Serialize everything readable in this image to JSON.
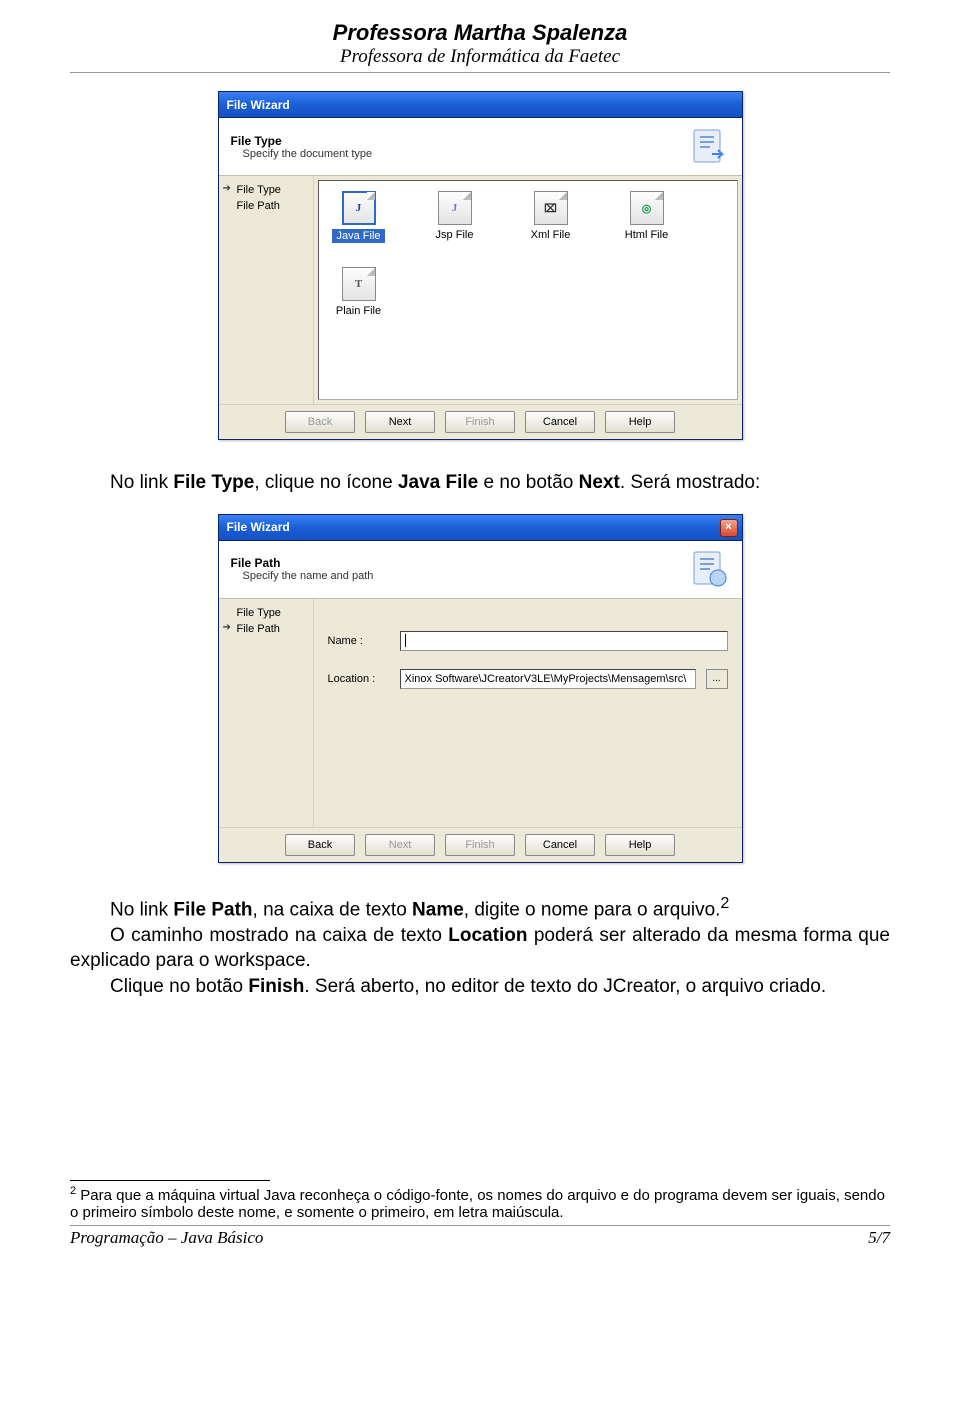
{
  "header": {
    "title": "Professora Martha Spalenza",
    "sub": "Professora de Informática da Faetec"
  },
  "dialog1": {
    "title": "File Wizard",
    "section_title": "File Type",
    "section_desc": "Specify the document type",
    "sidebar": {
      "items": [
        {
          "label": "File Type",
          "selected": true
        },
        {
          "label": "File Path",
          "selected": false
        }
      ]
    },
    "files": [
      {
        "label": "Java File",
        "glyph": "J",
        "color": "#1a3fb5",
        "selected": true
      },
      {
        "label": "Jsp File",
        "glyph": "J",
        "color": "#8a6ad0",
        "selected": false
      },
      {
        "label": "Xml File",
        "glyph": "⌧",
        "color": "#333",
        "selected": false
      },
      {
        "label": "Html File",
        "glyph": "◎",
        "color": "#0a9a4a",
        "selected": false
      },
      {
        "label": "Plain File",
        "glyph": "T",
        "color": "#555",
        "selected": false
      }
    ],
    "buttons": {
      "back": "Back",
      "next": "Next",
      "finish": "Finish",
      "cancel": "Cancel",
      "help": "Help"
    }
  },
  "para1_pre": "No link ",
  "para1_b1": "File Type",
  "para1_mid": ", clique no ícone ",
  "para1_b2": "Java File",
  "para1_mid2": " e no botão ",
  "para1_b3": "Next",
  "para1_post": ". Será mostrado:",
  "dialog2": {
    "title": "File Wizard",
    "section_title": "File Path",
    "section_desc": "Specify the name and path",
    "sidebar": {
      "items": [
        {
          "label": "File Type",
          "selected": false
        },
        {
          "label": "File Path",
          "selected": true
        }
      ]
    },
    "form": {
      "name_label": "Name :",
      "name_value": "",
      "location_label": "Location :",
      "location_value": "Xinox Software\\JCreatorV3LE\\MyProjects\\Mensagem\\src\\",
      "browse": "..."
    },
    "buttons": {
      "back": "Back",
      "next": "Next",
      "finish": "Finish",
      "cancel": "Cancel",
      "help": "Help"
    }
  },
  "para2": {
    "l1_pre": "No link ",
    "l1_b1": "File Path",
    "l1_mid": ", na caixa de texto ",
    "l1_b2": "Name",
    "l1_post": ", digite o nome para o arquivo.",
    "sup": "2",
    "l2_pre": "O caminho mostrado na caixa de texto ",
    "l2_b1": "Location",
    "l2_post": " poderá ser alterado da mesma forma que explicado para o workspace.",
    "l3_pre": "Clique no botão ",
    "l3_b1": "Finish",
    "l3_post": ". Será aberto, no editor de texto do JCreator, o arquivo criado."
  },
  "footnote": {
    "sup": "2",
    "text": " Para que a máquina virtual Java reconheça o código-fonte, os nomes do arquivo e do programa devem ser iguais, sendo o primeiro símbolo deste nome, e somente o primeiro, em letra maiúscula."
  },
  "footer": {
    "left": "Programação – Java Básico",
    "right": "5/7"
  }
}
